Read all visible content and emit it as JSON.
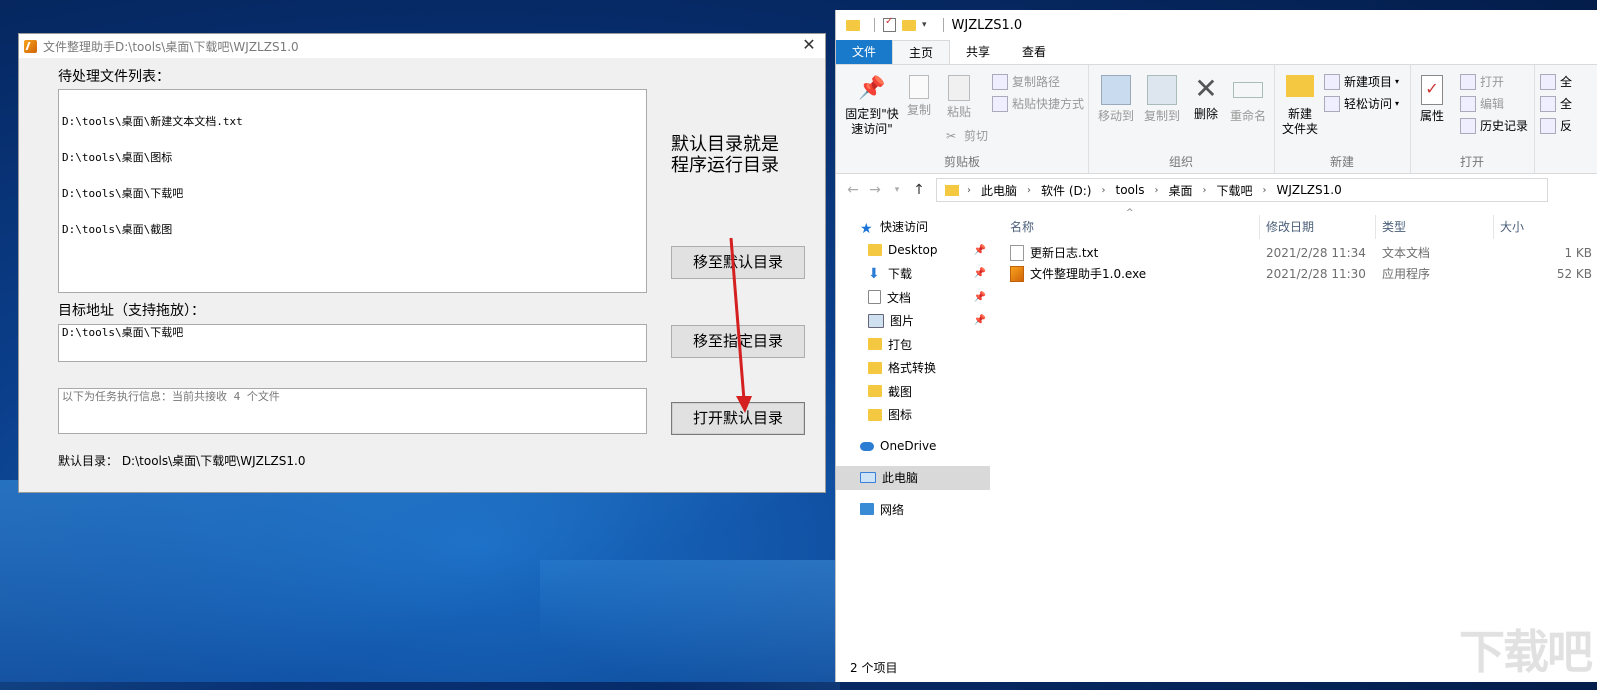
{
  "app": {
    "title": "文件整理助手D:\\tools\\桌面\\下载吧\\WJZLZS1.0",
    "close_glyph": "✕",
    "pending_label": "待处理文件列表：",
    "pending_files": [
      "D:\\tools\\桌面\\新建文本文档.txt",
      "D:\\tools\\桌面\\图标",
      "D:\\tools\\桌面\\下载吧",
      "D:\\tools\\桌面\\截图"
    ],
    "note_line1": "默认目录就是",
    "note_line2": "程序运行目录",
    "target_label": "目标地址（支持拖放）：",
    "target_value": "D:\\tools\\桌面\\下载吧",
    "info_text": "以下为任务执行信息：当前共接收 4 个文件",
    "btn_move_default": "移至默认目录",
    "btn_move_specified": "移至指定目录",
    "btn_open_default": "打开默认目录",
    "default_dir_line": "默认目录： D:\\tools\\桌面\\下载吧\\WJZLZS1.0",
    "arrow_color": "#d42020"
  },
  "explorer": {
    "title": "WJZLZS1.0",
    "tabs": [
      "文件",
      "主页",
      "共享",
      "查看"
    ],
    "ribbon": {
      "pin_quick_1": "固定到\"快",
      "pin_quick_2": "速访问\"",
      "copy": "复制",
      "paste": "粘贴",
      "copy_path": "复制路径",
      "paste_shortcut": "粘贴快捷方式",
      "cut": "剪切",
      "clipboard_group": "剪贴板",
      "move_to": "移动到",
      "copy_to": "复制到",
      "delete": "删除",
      "rename": "重命名",
      "organize_group": "组织",
      "new_folder_1": "新建",
      "new_folder_2": "文件夹",
      "new_item": "新建项目",
      "easy_access": "轻松访问",
      "new_group": "新建",
      "properties": "属性",
      "open": "打开",
      "edit": "编辑",
      "history": "历史记录",
      "open_group": "打开",
      "select_all_partial": "全",
      "select_none_partial": "全",
      "invert_partial": "反"
    },
    "breadcrumb": [
      "此电脑",
      "软件 (D:)",
      "tools",
      "桌面",
      "下载吧",
      "WJZLZS1.0"
    ],
    "nav": [
      {
        "label": "快速访问",
        "icon": "star-icon",
        "pinned": false
      },
      {
        "label": "Desktop",
        "icon": "folder-icon",
        "pinned": true
      },
      {
        "label": "下载",
        "icon": "download-icon",
        "pinned": true
      },
      {
        "label": "文档",
        "icon": "document-icon",
        "pinned": true
      },
      {
        "label": "图片",
        "icon": "picture-icon",
        "pinned": true
      },
      {
        "label": "打包",
        "icon": "folder-icon",
        "pinned": false
      },
      {
        "label": "格式转换",
        "icon": "folder-icon",
        "pinned": false
      },
      {
        "label": "截图",
        "icon": "folder-icon",
        "pinned": false
      },
      {
        "label": "图标",
        "icon": "folder-icon",
        "pinned": false
      },
      {
        "label": "OneDrive",
        "icon": "cloud-icon",
        "pinned": false
      },
      {
        "label": "此电脑",
        "icon": "computer-icon",
        "pinned": false
      },
      {
        "label": "网络",
        "icon": "network-icon",
        "pinned": false
      }
    ],
    "columns": [
      "名称",
      "修改日期",
      "类型",
      "大小"
    ],
    "files": [
      {
        "name": "更新日志.txt",
        "date": "2021/2/28 11:34",
        "type": "文本文档",
        "size": "1 KB"
      },
      {
        "name": "文件整理助手1.0.exe",
        "date": "2021/2/28 11:30",
        "type": "应用程序",
        "size": "52 KB"
      }
    ],
    "status": "2 个项目"
  },
  "watermark": "下载吧"
}
